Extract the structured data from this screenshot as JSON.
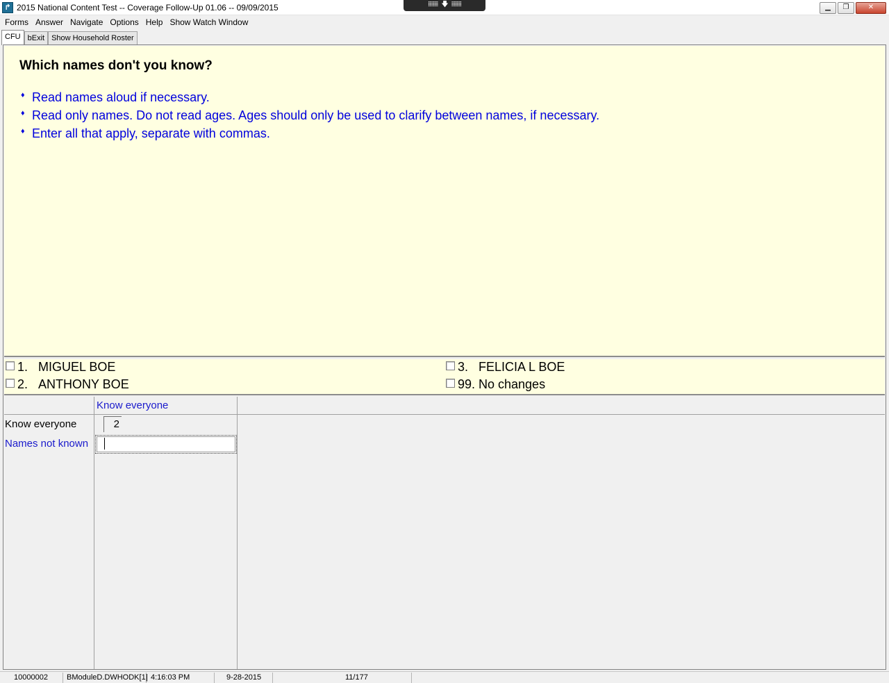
{
  "window": {
    "title": "2015 National Content Test -- Coverage Follow-Up 01.06 -- 09/09/2015",
    "app_icon": "arrow-icon",
    "remote_bar": "⁞⁞⁞⁞⁞⁞⁞⁞ 🡇 ⁞⁞⁞⁞⁞⁞⁞⁞"
  },
  "menu": [
    "Forms",
    "Answer",
    "Navigate",
    "Options",
    "Help",
    "Show Watch Window"
  ],
  "tabs": [
    "CFU",
    "bExit",
    "Show Household Roster"
  ],
  "question": {
    "text": "Which names don't you know?",
    "instructions": [
      "Read names aloud if necessary.",
      "Read only names. Do not read ages. Ages should only be used to clarify between names, if necessary.",
      "Enter all that apply, separate with commas."
    ]
  },
  "answers": [
    {
      "num": "1.",
      "label": "MIGUEL  BOE"
    },
    {
      "num": "2.",
      "label": "ANTHONY  BOE"
    },
    {
      "num": "3.",
      "label": "FELICIA L BOE"
    },
    {
      "num": "99.",
      "label": "No changes"
    }
  ],
  "grid": {
    "column_header": "Know everyone",
    "rows": [
      {
        "label": "Know everyone",
        "value": "2"
      },
      {
        "label": "Names not known",
        "value": ""
      }
    ]
  },
  "status": {
    "case_id": "10000002",
    "field": "BModuleD.DWHODK[1]",
    "time": "4:16:03 PM",
    "date": "9-28-2015",
    "page": "11/177"
  },
  "colors": {
    "question_bg": "#ffffe1",
    "instruction_blue": "#0000dd",
    "label_blue": "#1a1acc"
  }
}
